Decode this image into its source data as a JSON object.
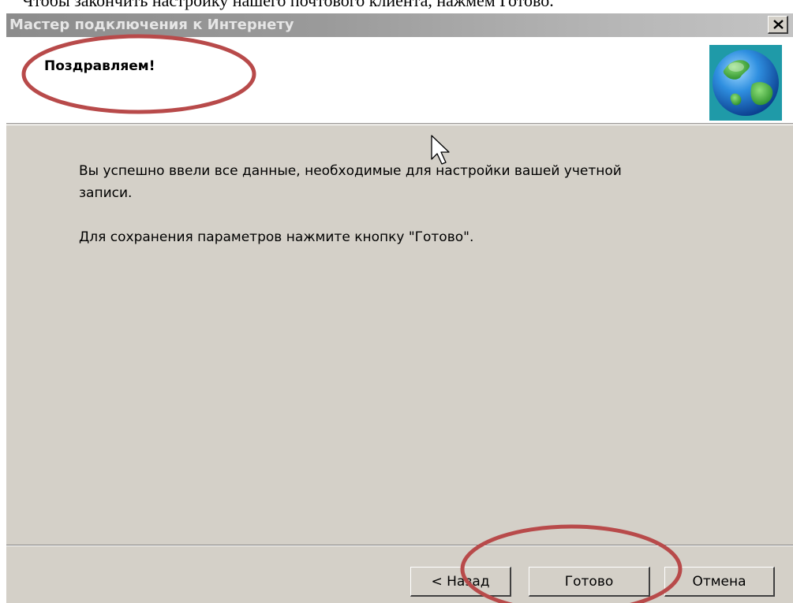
{
  "caption": {
    "text": "Чтобы закончить настройку нашего почтового клиента, нажмем Готово."
  },
  "window": {
    "title": "Мастер подключения к Интернету",
    "close_label": "×"
  },
  "header": {
    "title": "Поздравляем!",
    "icon": "globe-icon"
  },
  "content": {
    "line1": "Вы успешно ввели все данные, необходимые для настройки вашей учетной",
    "line2": "записи.",
    "line3": "Для сохранения параметров нажмите кнопку \"Готово\"."
  },
  "buttons": {
    "back_label": "< Назад",
    "finish_label": "Готово",
    "cancel_label": "Отмена"
  },
  "colors": {
    "annotation_ellipse": "#b84a4a",
    "dialog_face": "#d4d0c8",
    "inactive_titlebar": "#9a9a9a"
  }
}
